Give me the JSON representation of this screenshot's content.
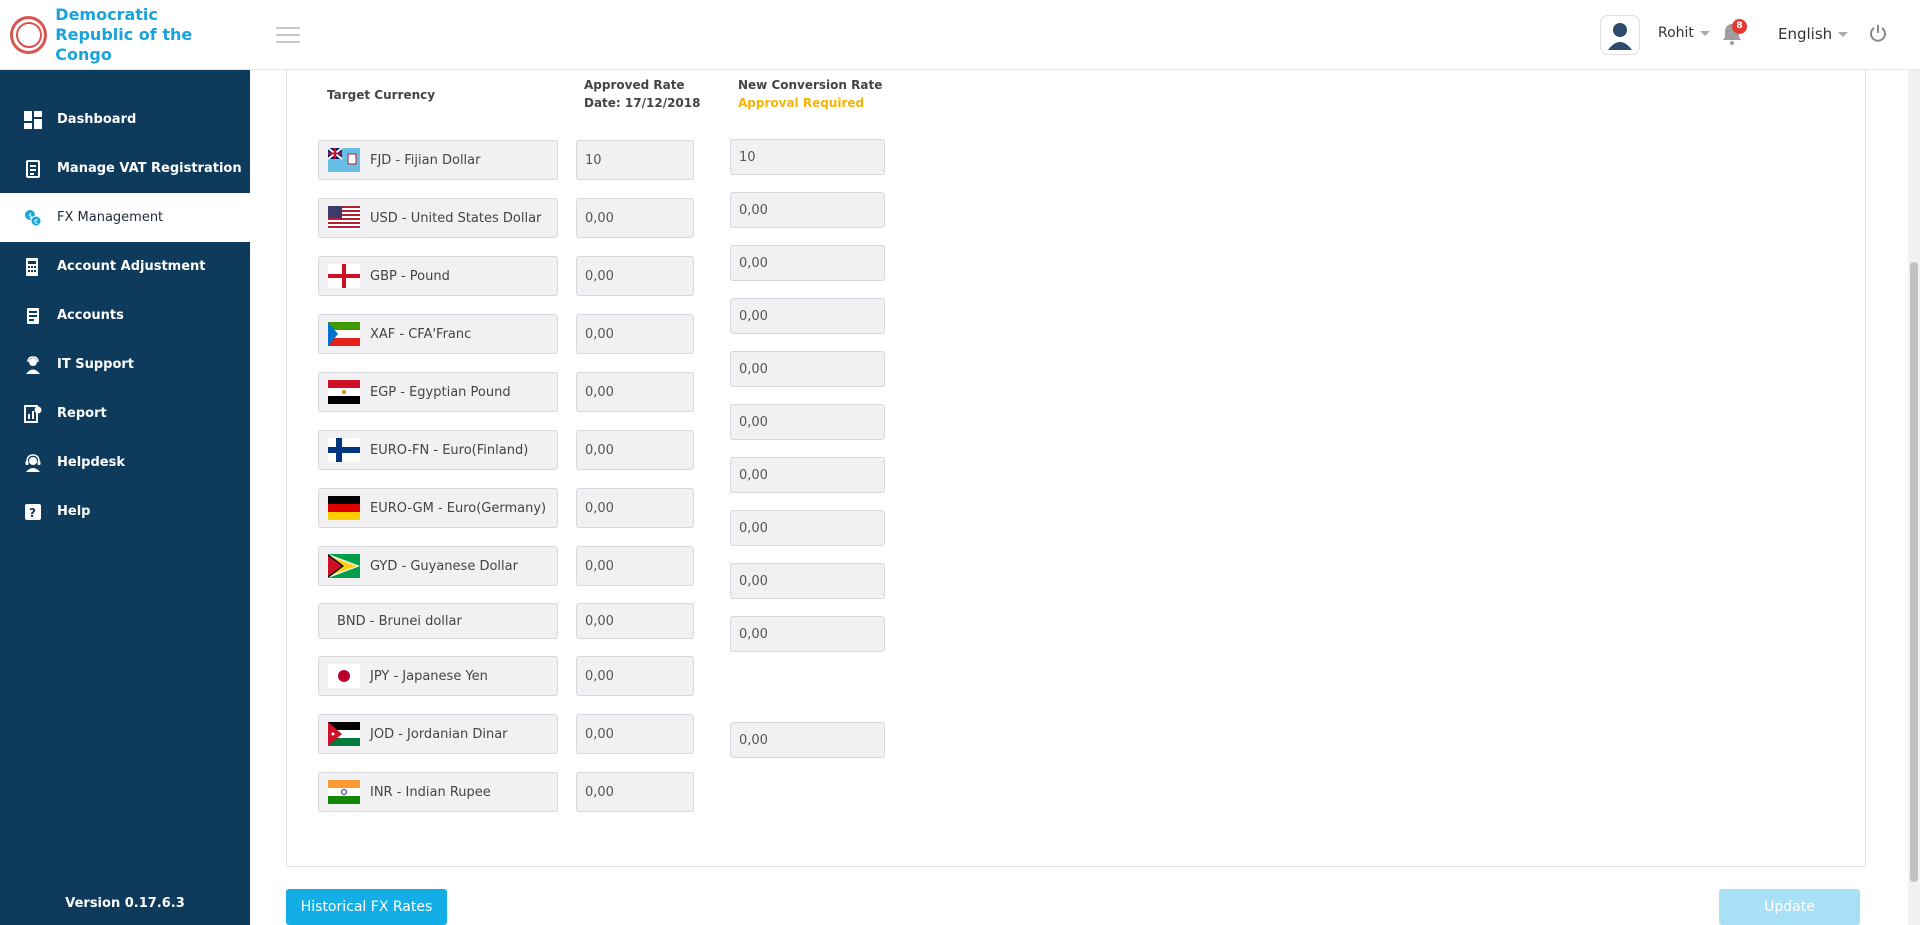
{
  "brand": {
    "line1": "Democratic",
    "line2": "Republic of the Congo"
  },
  "sidebar": {
    "items": [
      {
        "label": "Dashboard",
        "icon": "dashboard-icon"
      },
      {
        "label": "Manage VAT Registration",
        "icon": "vat-registration-icon"
      },
      {
        "label": "FX Management",
        "icon": "fx-management-icon"
      },
      {
        "label": "Account Adjustment",
        "icon": "account-adjustment-icon"
      },
      {
        "label": "Accounts",
        "icon": "accounts-icon"
      },
      {
        "label": "IT Support",
        "icon": "it-support-icon"
      },
      {
        "label": "Report",
        "icon": "report-icon"
      },
      {
        "label": "Helpdesk",
        "icon": "helpdesk-icon"
      },
      {
        "label": "Help",
        "icon": "help-icon"
      }
    ],
    "active": "FX Management",
    "version": "Version 0.17.6.3"
  },
  "header": {
    "user_name": "Rohit",
    "notification_count": "8",
    "language": "English"
  },
  "table": {
    "col_currency": "Target Currency",
    "col_approved_line1": "Approved Rate",
    "col_approved_line2": "Date: 17/12/2018",
    "col_new_line1": "New Conversion Rate",
    "col_new_line2": "Approval Required",
    "rows": [
      {
        "currency": "FJD - Fijian Dollar",
        "flag": "fiji-flag",
        "approved": "10",
        "new": "10"
      },
      {
        "currency": "USD - United States Dollar",
        "flag": "usa-flag",
        "approved": "0,00",
        "new": "0,00"
      },
      {
        "currency": "GBP - Pound",
        "flag": "england-flag",
        "approved": "0,00",
        "new": "0,00"
      },
      {
        "currency": "XAF - CFA'Franc",
        "flag": "equatorial-guinea-flag",
        "approved": "0,00",
        "new": "0,00"
      },
      {
        "currency": "EGP - Egyptian Pound",
        "flag": "egypt-flag",
        "approved": "0,00",
        "new": "0,00"
      },
      {
        "currency": "EURO-FN - Euro(Finland)",
        "flag": "finland-flag",
        "approved": "0,00",
        "new": "0,00"
      },
      {
        "currency": "EURO-GM - Euro(Germany)",
        "flag": "germany-flag",
        "approved": "0,00",
        "new": "0,00"
      },
      {
        "currency": "GYD - Guyanese Dollar",
        "flag": "guyana-flag",
        "approved": "0,00",
        "new": "0,00"
      },
      {
        "currency": "BND - Brunei dollar",
        "flag": "",
        "approved": "0,00",
        "new": "0,00"
      },
      {
        "currency": "JPY - Japanese Yen",
        "flag": "japan-flag",
        "approved": "0,00",
        "new": "0,00"
      },
      {
        "currency": "JOD - Jordanian Dinar",
        "flag": "jordan-flag",
        "approved": "0,00",
        "new": "0,00"
      },
      {
        "currency": "INR - Indian Rupee",
        "flag": "india-flag",
        "approved": "0,00",
        "new": ""
      }
    ]
  },
  "buttons": {
    "historical": "Historical FX Rates",
    "update": "Update"
  },
  "colors": {
    "sidebar": "#0e3a5c",
    "accent": "#14aee6",
    "warning": "#f5b400"
  }
}
